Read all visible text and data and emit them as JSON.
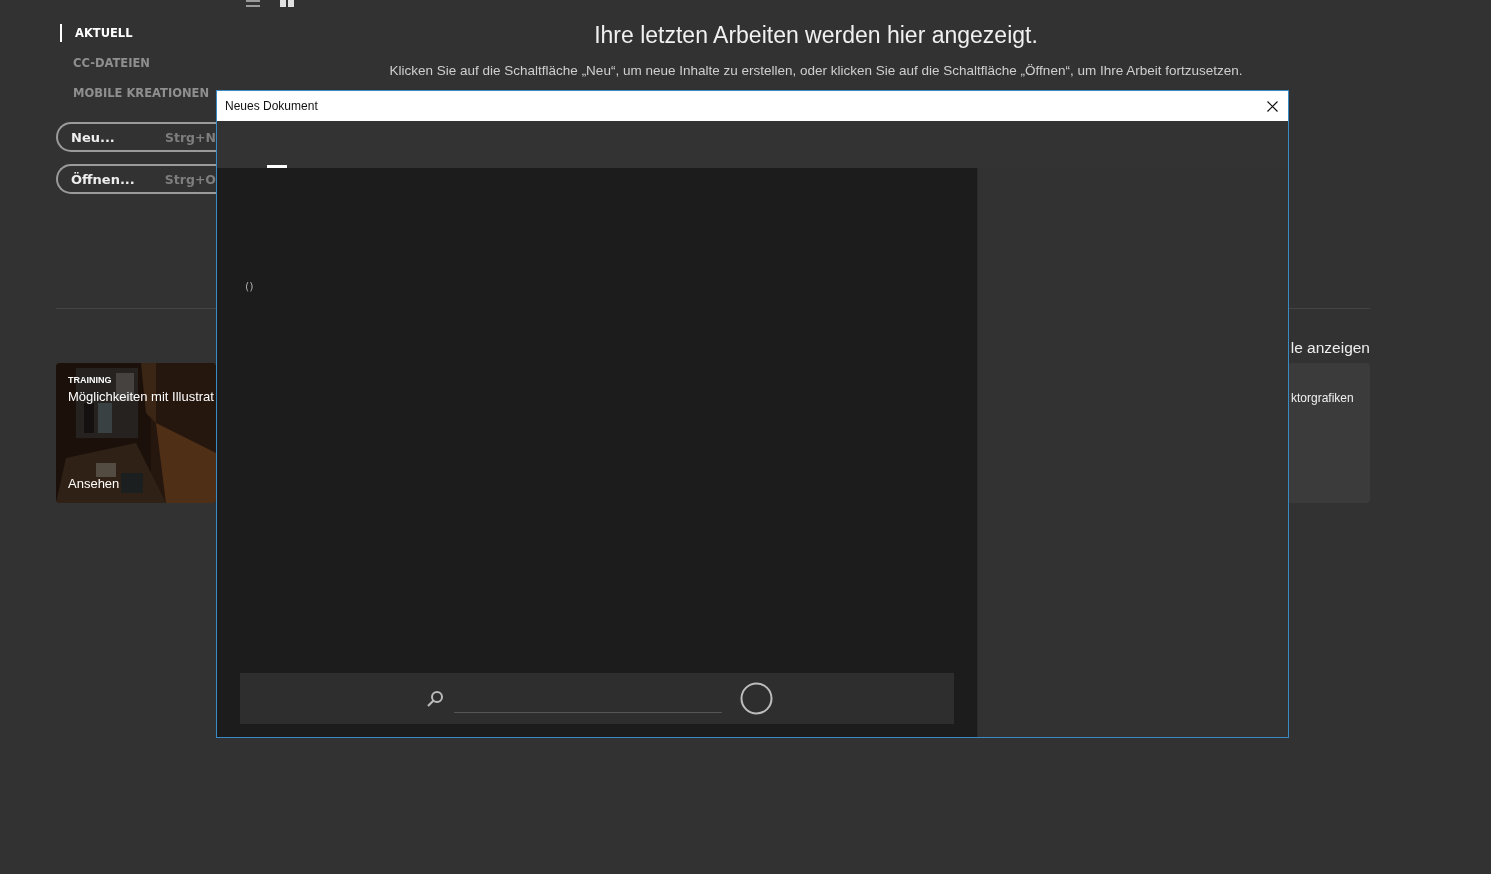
{
  "sidebar": {
    "items": [
      {
        "label": "AKTUELL",
        "selected": true
      },
      {
        "label": "CC-DATEIEN",
        "selected": false
      },
      {
        "label": "MOBILE KREATIONEN",
        "selected": false
      }
    ],
    "buttons": [
      {
        "label": "Neu...",
        "shortcut": "Strg+N"
      },
      {
        "label": "Öffnen...",
        "shortcut": "Strg+O"
      }
    ]
  },
  "header": {
    "heading": "Ihre letzten Arbeiten werden hier angezeigt.",
    "subtitle": "Klicken Sie auf die Schaltfläche „Neu“, um neue Inhalte zu erstellen, oder klicken Sie auf die Schaltfläche „Öffnen“, um Ihre Arbeit fortzusetzen."
  },
  "tutorials": {
    "link": "le anzeigen",
    "cards": [
      {
        "kind": "picture",
        "tag": "TRAINING",
        "title": "Möglichkeiten mit Illustrat",
        "action": "Ansehen"
      },
      {
        "kind": "plain",
        "title": "ktorgrafiken"
      }
    ]
  },
  "dialog": {
    "title": "Neues Dokument",
    "content_text": "()"
  }
}
